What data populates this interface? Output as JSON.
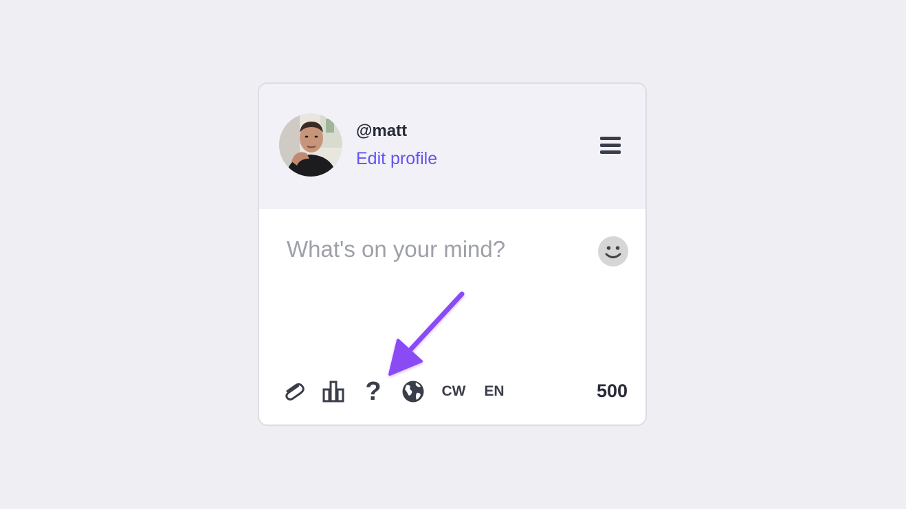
{
  "profile": {
    "handle": "@matt",
    "edit_label": "Edit profile"
  },
  "composer": {
    "placeholder": "What's on your mind?",
    "value": ""
  },
  "toolbar": {
    "items": [
      {
        "icon": "paperclip-icon",
        "label": ""
      },
      {
        "icon": "poll-icon",
        "label": ""
      },
      {
        "icon": "question-icon",
        "label": "?"
      },
      {
        "icon": "globe-icon",
        "label": ""
      },
      {
        "icon": "content-warning-button",
        "label": "CW"
      },
      {
        "icon": "language-button",
        "label": "EN"
      }
    ],
    "char_counter": "500"
  },
  "annotation": {
    "arrow_color": "#8a4cf5"
  },
  "colors": {
    "accent": "#6353f2",
    "text": "#282c37",
    "background": "#efeef3"
  }
}
